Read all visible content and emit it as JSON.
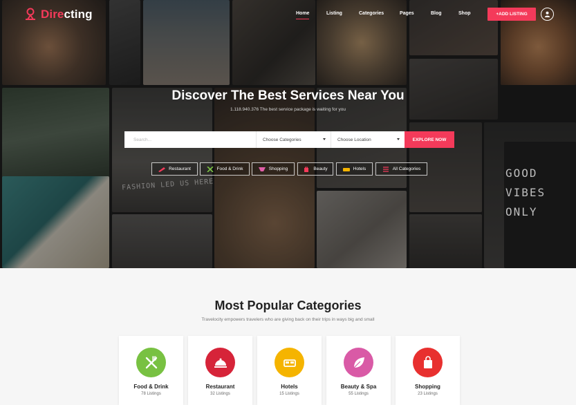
{
  "brand": {
    "logo_prefix": "Dire",
    "logo_suffix": "cting",
    "accent": "#f43a5a"
  },
  "nav": {
    "items": [
      {
        "label": "Home",
        "active": true
      },
      {
        "label": "Listing"
      },
      {
        "label": "Categories"
      },
      {
        "label": "Pages"
      },
      {
        "label": "Blog"
      },
      {
        "label": "Shop"
      }
    ],
    "add_listing_label": "+ADD LISTING",
    "user_icon": "user-icon"
  },
  "hero": {
    "title": "Discover The Best Services Near You",
    "subtitle": "1.118.940.376 The best service package is waiting for you",
    "photo_text": [
      "GOOD",
      "VIBES",
      "ONLY",
      "FASHION LED US HERE"
    ]
  },
  "search": {
    "placeholder": "Search...",
    "category_select": "Choose Categories",
    "location_select": "Choose Location",
    "button_label": "EXPLORE NOW"
  },
  "quick_categories": [
    {
      "label": "Restaurant",
      "icon": "restaurant-icon",
      "color": "#f43a5a"
    },
    {
      "label": "Food & Drink",
      "icon": "fork-knife-icon",
      "color": "#7cc545"
    },
    {
      "label": "Shopping",
      "icon": "shopping-icon",
      "color": "#e05fa8"
    },
    {
      "label": "Beauty",
      "icon": "beauty-bag-icon",
      "color": "#f43a5a"
    },
    {
      "label": "Hotels",
      "icon": "bed-icon",
      "color": "#f5b400"
    },
    {
      "label": "All Categories",
      "icon": "list-icon",
      "color": "#f43a5a"
    }
  ],
  "popular": {
    "title": "Most Popular Categories",
    "subtitle": "Travelocity empowers travelers who are giving back on their trips in ways big and small",
    "cards": [
      {
        "name": "Food & Drink",
        "count": "78 Listings",
        "icon": "fork-knife-icon",
        "color": "#78c142"
      },
      {
        "name": "Restaurant",
        "count": "32 Listings",
        "icon": "cloche-icon",
        "color": "#d62439"
      },
      {
        "name": "Hotels",
        "count": "15 Listings",
        "icon": "bed-icon",
        "color": "#f5b400"
      },
      {
        "name": "Beauty & Spa",
        "count": "55 Listings",
        "icon": "leaf-icon",
        "color": "#d95aa6"
      },
      {
        "name": "Shopping",
        "count": "23 Listings",
        "icon": "shopping-bag-icon",
        "color": "#e8302f"
      }
    ]
  }
}
